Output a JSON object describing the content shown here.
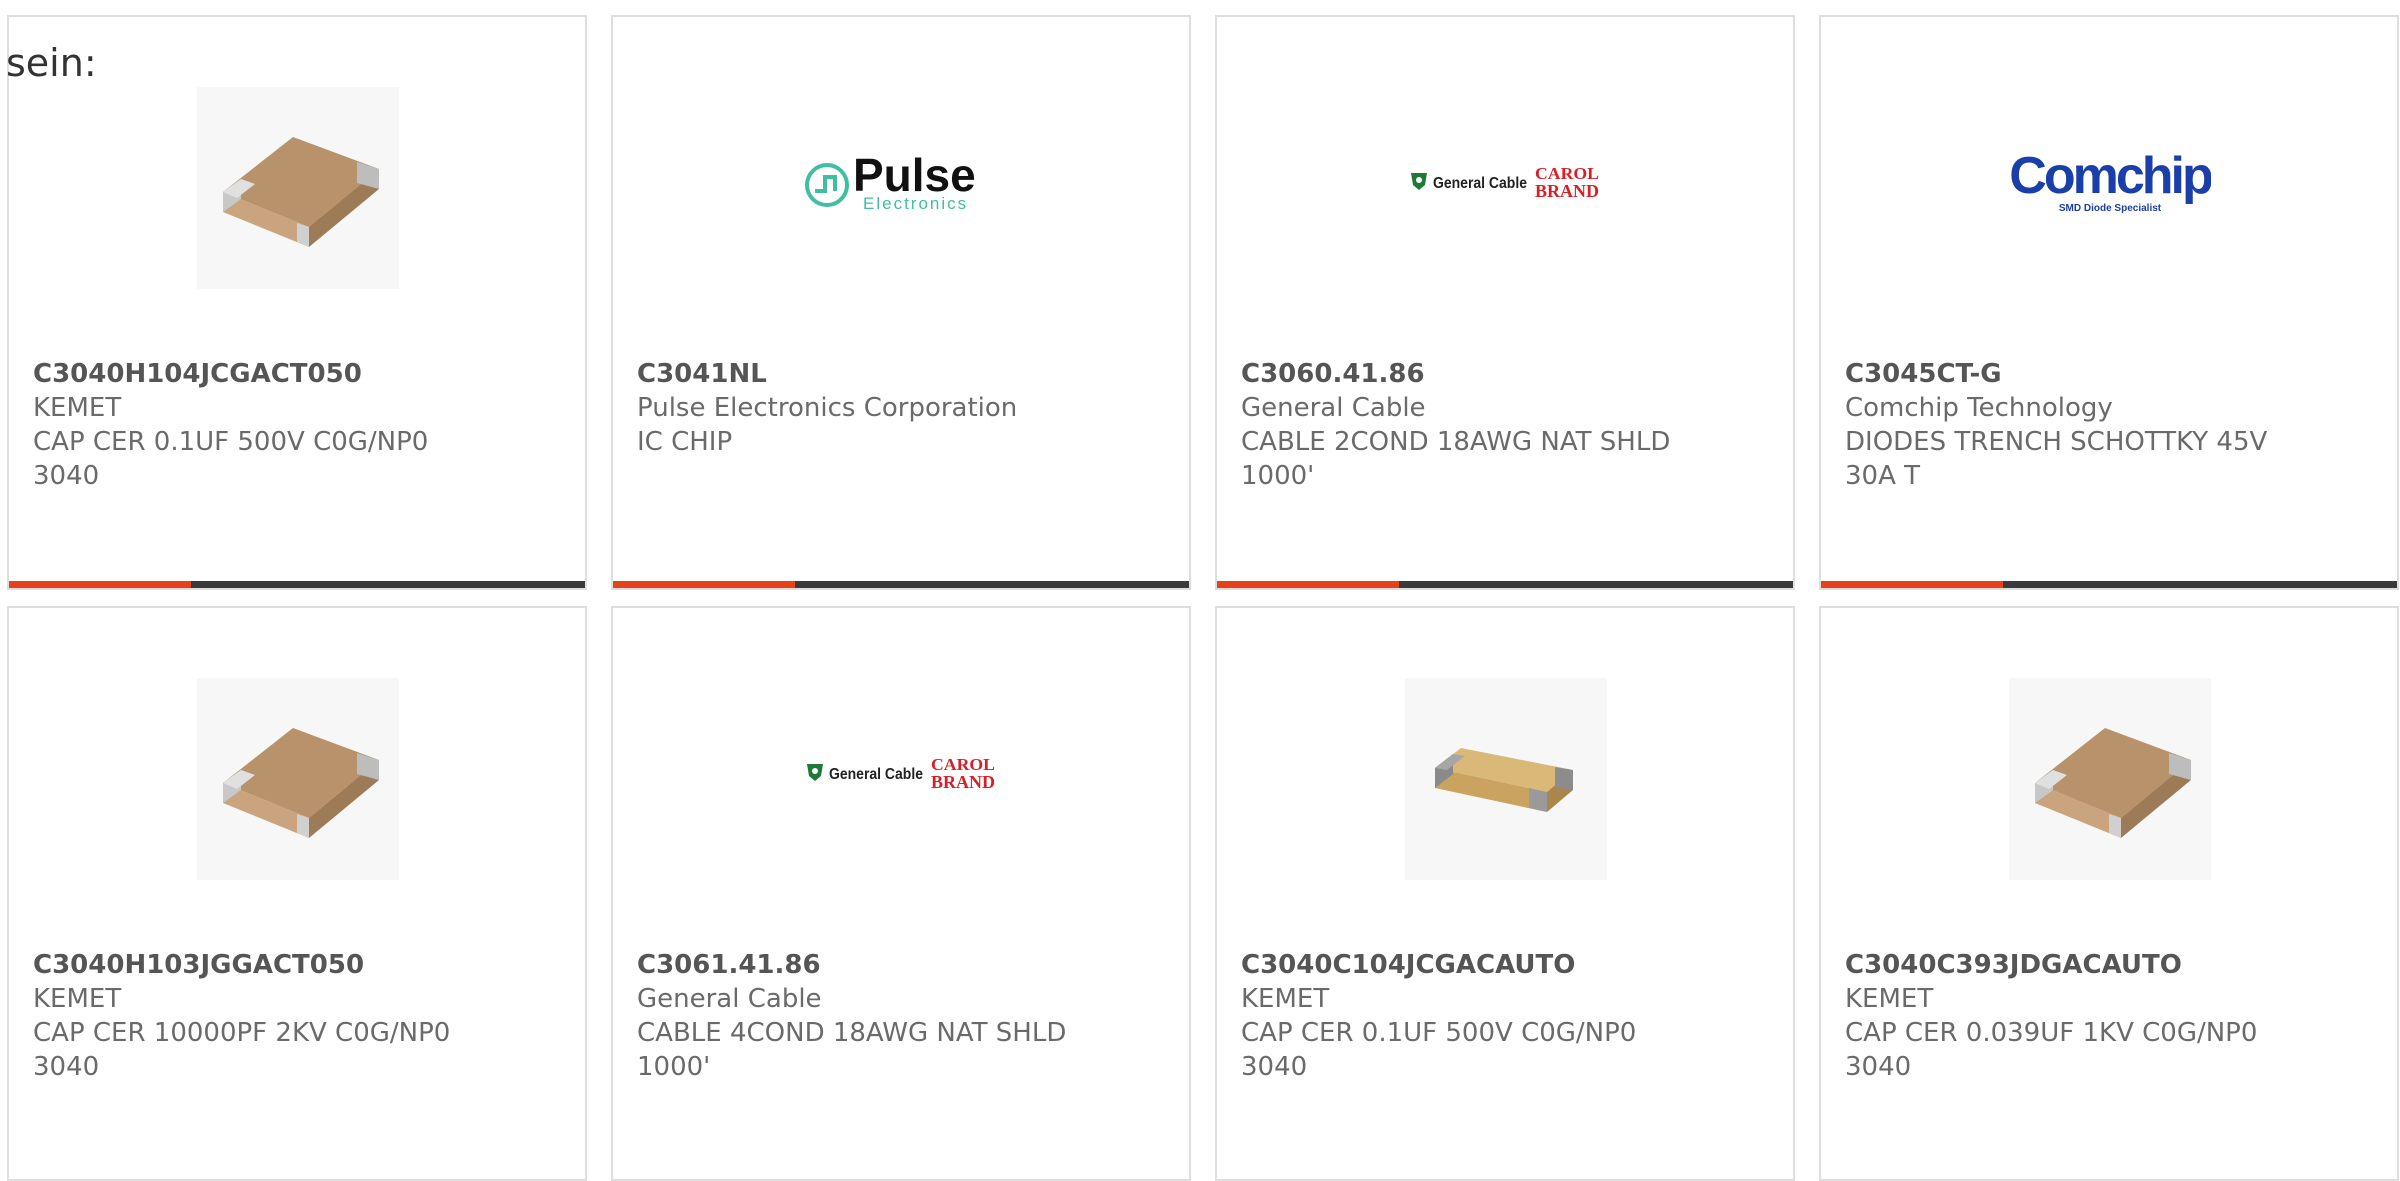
{
  "intro_text": "sein:",
  "colors": {
    "accent": "#e8411a",
    "bar": "#3a3a3a",
    "border": "#dedede",
    "pulse_green": "#3fbf9f",
    "comchip_blue": "#1b3fa8",
    "carol_red": "#d81f26",
    "gc_green": "#1f7a3a"
  },
  "products": [
    {
      "part_number": "C3040H104JCGACT050",
      "manufacturer": "KEMET",
      "description": "CAP CER 0.1UF 500V C0G/NP0 3040",
      "image": "capacitor-icon"
    },
    {
      "part_number": "C3041NL",
      "manufacturer": "Pulse Electronics Corporation",
      "description": "IC CHIP",
      "image": "pulse-electronics-logo",
      "logo": {
        "name": "Pulse",
        "sub": "Electronics"
      }
    },
    {
      "part_number": "C3060.41.86",
      "manufacturer": "General Cable",
      "description": "CABLE 2COND 18AWG NAT SHLD 1000'",
      "image": "general-cable-logo",
      "logo": {
        "name": "General Cable",
        "brand_top": "CAROL",
        "brand_bottom": "BRAND"
      }
    },
    {
      "part_number": "C3045CT-G",
      "manufacturer": "Comchip Technology",
      "description": "DIODES TRENCH SCHOTTKY 45V 30A T",
      "image": "comchip-logo",
      "logo": {
        "name": "Comchip",
        "sub": "SMD Diode Specialist"
      }
    },
    {
      "part_number": "C3040H103JGGACT050",
      "manufacturer": "KEMET",
      "description": "CAP CER 10000PF 2KV C0G/NP0 3040",
      "image": "capacitor-icon"
    },
    {
      "part_number": "C3061.41.86",
      "manufacturer": "General Cable",
      "description": "CABLE 4COND 18AWG NAT SHLD 1000'",
      "image": "general-cable-logo",
      "logo": {
        "name": "General Cable",
        "brand_top": "CAROL",
        "brand_bottom": "BRAND"
      }
    },
    {
      "part_number": "C3040C104JCGACAUTO",
      "manufacturer": "KEMET",
      "description": "CAP CER 0.1UF 500V C0G/NP0 3040",
      "image": "capacitor-icon"
    },
    {
      "part_number": "C3040C393JDGACAUTO",
      "manufacturer": "KEMET",
      "description": "CAP CER 0.039UF 1KV C0G/NP0 3040",
      "image": "capacitor-icon"
    }
  ]
}
